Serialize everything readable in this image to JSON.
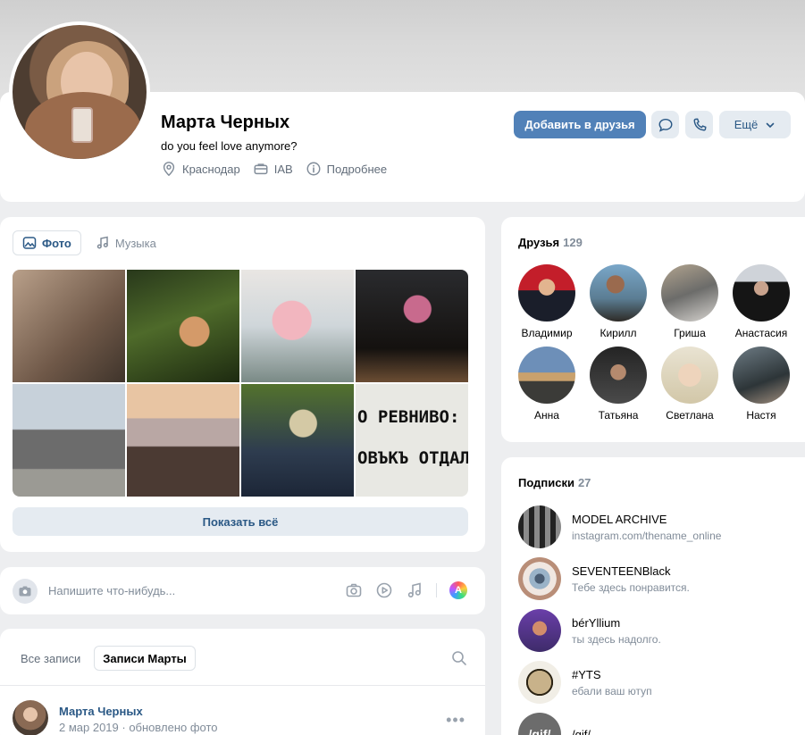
{
  "profile": {
    "name": "Марта Черных",
    "status": "do you feel love anymore?",
    "city": "Краснодар",
    "work": "IAB",
    "more_info": "Подробнее",
    "add_friend": "Добавить в друзья",
    "more_button": "Ещё"
  },
  "media_tabs": {
    "photos": "Фото",
    "music": "Музыка"
  },
  "photo_text": "О РЕВНИВО: ОНО Т\nОВЪКЪ ОТДАЛСЯ ЕМ",
  "show_all": "Показать всё",
  "compose": {
    "placeholder": "Напишите что-нибудь..."
  },
  "wall": {
    "tab_all": "Все записи",
    "tab_own": "Записи Марты",
    "post": {
      "author": "Марта Черных",
      "meta": "2 мар 2019 · обновлено фото"
    }
  },
  "friends": {
    "title": "Друзья",
    "count": "129",
    "items": [
      {
        "name": "Владимир"
      },
      {
        "name": "Кирилл"
      },
      {
        "name": "Гриша"
      },
      {
        "name": "Анастасия"
      },
      {
        "name": "Анна"
      },
      {
        "name": "Татьяна"
      },
      {
        "name": "Светлана"
      },
      {
        "name": "Настя"
      }
    ]
  },
  "subscriptions": {
    "title": "Подписки",
    "count": "27",
    "items": [
      {
        "name": "MODEL ARCHIVE",
        "desc": "instagram.com/thename_online"
      },
      {
        "name": "SEVENTEENBlack",
        "desc": "Тебе здесь понравится."
      },
      {
        "name": "bérYllium",
        "desc": "ты здесь надолго."
      },
      {
        "name": "#YTS",
        "desc": "ебали ваш ютуп"
      },
      {
        "name": "/gif/",
        "desc": "",
        "avatar_text": "/gif/"
      }
    ]
  },
  "colors": {
    "accent": "#5181b8",
    "link": "#2a5885",
    "muted": "#818c99",
    "background": "#edeef0"
  }
}
